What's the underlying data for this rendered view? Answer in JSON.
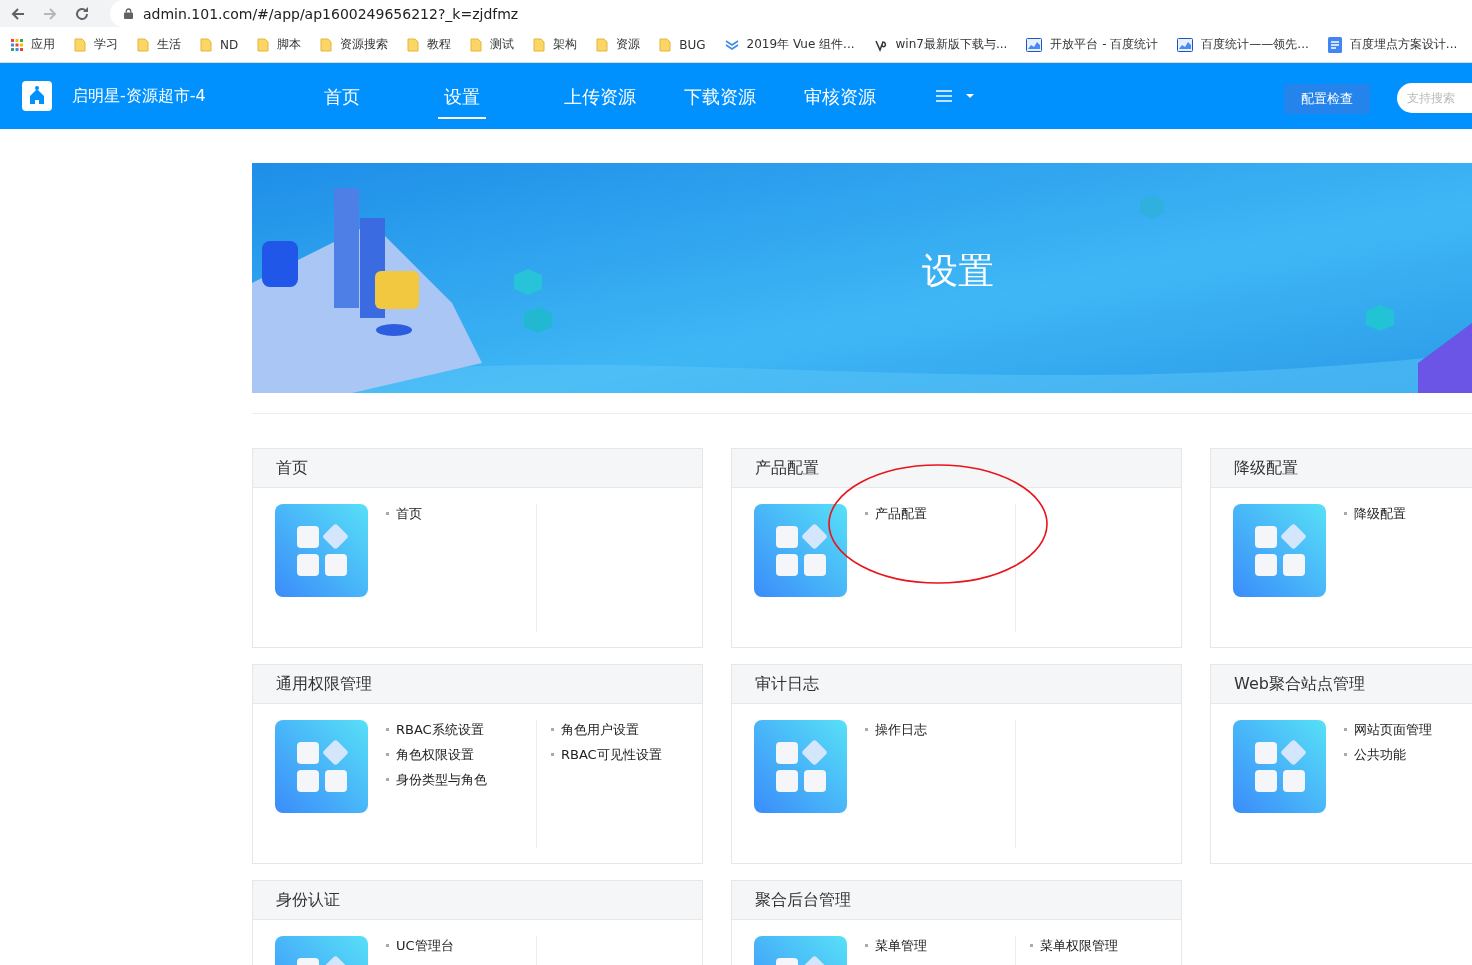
{
  "browser": {
    "nav": [
      {
        "kind": "back",
        "disabled": false
      },
      {
        "kind": "forward",
        "disabled": true
      },
      {
        "kind": "reload",
        "disabled": false
      }
    ],
    "url": "admin.101.com/#/app/ap1600249656212?_k=zjdfmz",
    "bookmarks": [
      {
        "kind": "apps",
        "label": "应用"
      },
      {
        "kind": "folder",
        "label": "学习"
      },
      {
        "kind": "folder",
        "label": "生活"
      },
      {
        "kind": "folder",
        "label": "ND"
      },
      {
        "kind": "folder",
        "label": "脚本"
      },
      {
        "kind": "folder",
        "label": "资源搜索"
      },
      {
        "kind": "folder",
        "label": "教程"
      },
      {
        "kind": "folder",
        "label": "测试"
      },
      {
        "kind": "folder",
        "label": "架构"
      },
      {
        "kind": "folder",
        "label": "资源"
      },
      {
        "kind": "folder",
        "label": "BUG"
      },
      {
        "kind": "chevron",
        "label": "2019年 Vue 组件..."
      },
      {
        "kind": "glyph",
        "label": "win7最新版下载与..."
      },
      {
        "kind": "chart",
        "label": "开放平台 - 百度统计"
      },
      {
        "kind": "chart",
        "label": "百度统计——领先..."
      },
      {
        "kind": "doc",
        "label": "百度埋点方案设计..."
      }
    ]
  },
  "app": {
    "title": "启明星-资源超市-4",
    "nav": [
      {
        "label": "首页",
        "selected": false
      },
      {
        "label": "设置",
        "selected": true
      },
      {
        "label": "上传资源",
        "selected": false
      },
      {
        "label": "下载资源",
        "selected": false
      },
      {
        "label": "审核资源",
        "selected": false
      }
    ],
    "check_button": "配置检查",
    "search": {
      "placeholder": "支持搜索"
    }
  },
  "banner": {
    "title": "设置"
  },
  "cards": [
    {
      "title": "首页",
      "columns": [
        [
          "首页"
        ]
      ]
    },
    {
      "title": "产品配置",
      "columns": [
        [
          "产品配置"
        ]
      ],
      "annotated": true
    },
    {
      "title": "降级配置",
      "columns": [
        [
          "降级配置"
        ]
      ]
    },
    {
      "title": "通用权限管理",
      "columns": [
        [
          "RBAC系统设置",
          "角色权限设置",
          "身份类型与角色"
        ],
        [
          "角色用户设置",
          "RBAC可见性设置"
        ]
      ]
    },
    {
      "title": "审计日志",
      "columns": [
        [
          "操作日志"
        ]
      ]
    },
    {
      "title": "Web聚合站点管理",
      "columns": [
        [
          "网站页面管理",
          "公共功能"
        ]
      ]
    },
    {
      "title": "身份认证",
      "columns": [
        [
          "UC管理台"
        ]
      ]
    },
    {
      "title": "聚合后台管理",
      "columns": [
        [
          "菜单管理"
        ],
        [
          "菜单权限管理"
        ]
      ]
    }
  ]
}
